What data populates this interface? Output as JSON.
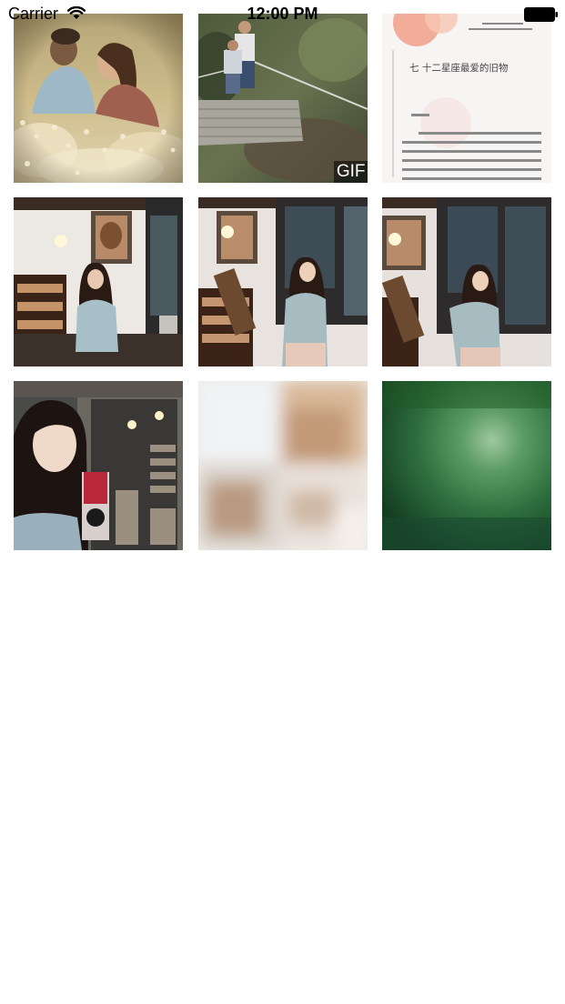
{
  "status_bar": {
    "carrier": "Carrier",
    "time": "12:00 PM",
    "wifi_icon": "wifi-icon",
    "battery_icon": "battery-icon"
  },
  "photos": [
    {
      "name": "couple-in-flower-field",
      "badge": ""
    },
    {
      "name": "rope-bridge-adventure",
      "badge": "GIF"
    },
    {
      "name": "chinese-text-page",
      "text_heading": "七 十二星座最爱的旧物",
      "badge": ""
    },
    {
      "name": "girl-in-cafe-1",
      "badge": ""
    },
    {
      "name": "girl-in-cafe-2",
      "badge": ""
    },
    {
      "name": "girl-in-cafe-3",
      "badge": ""
    },
    {
      "name": "girl-at-window",
      "badge": ""
    },
    {
      "name": "blurred-photo",
      "badge": ""
    },
    {
      "name": "green-blur-photo",
      "badge": ""
    }
  ]
}
